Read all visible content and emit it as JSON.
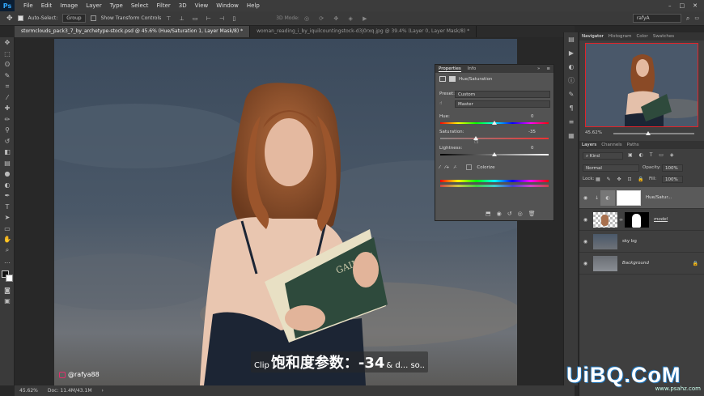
{
  "menubar": {
    "logo": "Ps",
    "items": [
      "File",
      "Edit",
      "Image",
      "Layer",
      "Type",
      "Select",
      "Filter",
      "3D",
      "View",
      "Window",
      "Help"
    ],
    "window_controls": [
      "–",
      "□",
      "✕"
    ]
  },
  "options_bar": {
    "auto_select_label": "Auto-Select:",
    "auto_select_mode": "Group",
    "show_transform_label": "Show Transform Controls",
    "mode_3d_label": "3D Mode:",
    "workspace": "rafyA"
  },
  "doc_tabs": [
    "stormclouds_pack3_7_by_archetype-stock.psd @ 45.6% (Hue/Saturation 1, Layer Mask/8) *",
    "woman_reading_i_by_iquilcountingstock-d3j0rxq.jpg @ 39.4% (Layer 0, Layer Mask/8) *"
  ],
  "status": {
    "zoom": "45.62%",
    "doc": "Doc: 11.4M/43.1M"
  },
  "watermark": "@rafya88",
  "subtitle": {
    "en_before": "Clip",
    "zh": "饱和度参数：-34",
    "en_after": "& d... so.."
  },
  "logo_wm": {
    "brand": "UiBQ.CoM",
    "site": "www.psahz.com"
  },
  "properties": {
    "tabs": [
      "Properties",
      "Info"
    ],
    "title": "Hue/Saturation",
    "preset_label": "Preset:",
    "preset_value": "Custom",
    "channel": "Master",
    "hue_label": "Hue:",
    "hue_value": "0",
    "saturation_label": "Saturation:",
    "saturation_value": "-35",
    "lightness_label": "Lightness:",
    "lightness_value": "0",
    "colorize_label": "Colorize",
    "hue_level": 0.5,
    "saturation_level": 0.33,
    "lightness_level": 0.5
  },
  "navigator": {
    "tabs": [
      "Navigator",
      "Histogram",
      "Color",
      "Swatches"
    ],
    "zoom": "45.62%"
  },
  "layers": {
    "tabs": [
      "Layers",
      "Channels",
      "Paths"
    ],
    "filter": "Kind",
    "blend_mode": "Normal",
    "opacity_label": "Opacity:",
    "opacity_value": "100%",
    "lock_label": "Lock:",
    "fill_label": "Fill:",
    "fill_value": "100%",
    "items": [
      {
        "name": "Hue/Satur..."
      },
      {
        "name": "model"
      },
      {
        "name": "sky bg"
      },
      {
        "name": "Background"
      }
    ]
  },
  "tools": [
    "move",
    "marquee",
    "lasso",
    "quick-select",
    "crop",
    "eyedropper",
    "healing",
    "brush",
    "stamp",
    "history-brush",
    "eraser",
    "gradient",
    "blur",
    "dodge",
    "pen",
    "type",
    "path-select",
    "shape",
    "hand",
    "zoom",
    "more",
    "colors",
    "quick-mask",
    "screen-mode",
    "artboard"
  ],
  "colors": {
    "accent": "#31a8ff",
    "panel": "#535353",
    "nav_frame": "#e0242a"
  }
}
